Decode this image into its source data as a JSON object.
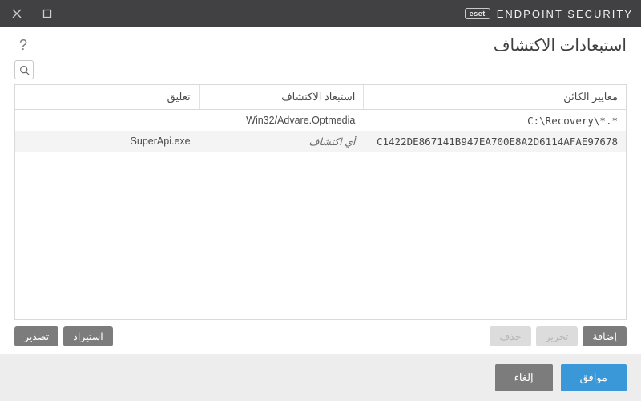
{
  "brand": {
    "logo": "eset",
    "product": "ENDPOINT SECURITY"
  },
  "page": {
    "title": "استبعادات الاكتشاف"
  },
  "columns": {
    "criteria": "معايير الكائن",
    "detection": "استبعاد الاكتشاف",
    "comment": "تعليق"
  },
  "rows": [
    {
      "criteria": "C:\\Recovery\\*.*",
      "detection": "Win32/Advare.Optmedia",
      "comment": ""
    },
    {
      "criteria": "C1422DE867141B947EA700E8A2D6114AFAE97678",
      "detection": "أي اكتشاف",
      "detection_italic": true,
      "comment": "SuperApi.exe"
    }
  ],
  "actions": {
    "add": "إضافة",
    "edit": "تحرير",
    "delete": "حذف",
    "import": "استيراد",
    "export": "تصدير"
  },
  "footer": {
    "ok": "موافق",
    "cancel": "إلغاء"
  }
}
